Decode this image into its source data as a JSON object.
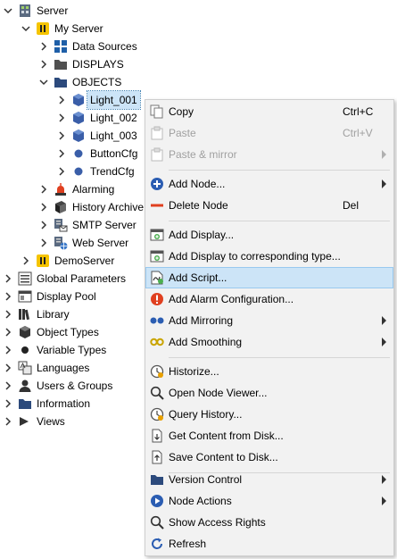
{
  "tree": {
    "server": "Server",
    "my_server": "My Server",
    "data_sources": "Data Sources",
    "displays": "DISPLAYS",
    "objects": "OBJECTS",
    "light_001": "Light_001",
    "light_002": "Light_002",
    "light_003": "Light_003",
    "button_cfg": "ButtonCfg",
    "trend_cfg": "TrendCfg",
    "alarming": "Alarming",
    "history_archive": "History Archive",
    "smtp_server": "SMTP Server",
    "web_server": "Web Server",
    "demo_server": "DemoServer",
    "global_parameters": "Global Parameters",
    "display_pool": "Display Pool",
    "library": "Library",
    "object_types": "Object Types",
    "variable_types": "Variable Types",
    "languages": "Languages",
    "users_groups": "Users & Groups",
    "information": "Information",
    "views": "Views"
  },
  "menu": {
    "copy": "Copy",
    "copy_key": "Ctrl+C",
    "paste": "Paste",
    "paste_key": "Ctrl+V",
    "paste_mirror": "Paste & mirror",
    "add_node": "Add Node...",
    "delete_node": "Delete Node",
    "delete_key": "Del",
    "add_display": "Add Display...",
    "add_display_type": "Add Display to corresponding type...",
    "add_script": "Add Script...",
    "add_alarm": "Add Alarm Configuration...",
    "add_mirroring": "Add Mirroring",
    "add_smoothing": "Add Smoothing",
    "historize": "Historize...",
    "open_node_viewer": "Open Node Viewer...",
    "query_history": "Query History...",
    "get_content": "Get Content from Disk...",
    "save_content": "Save Content to Disk...",
    "version_control": "Version Control",
    "node_actions": "Node Actions",
    "show_access_rights": "Show Access Rights",
    "refresh": "Refresh"
  },
  "colors": {
    "selection": "#cce4f7",
    "node_blue": "#3a5ea8",
    "folder": "#2c4a7c",
    "alarm_red": "#e04020",
    "menu_bg": "#f2f2f2"
  }
}
